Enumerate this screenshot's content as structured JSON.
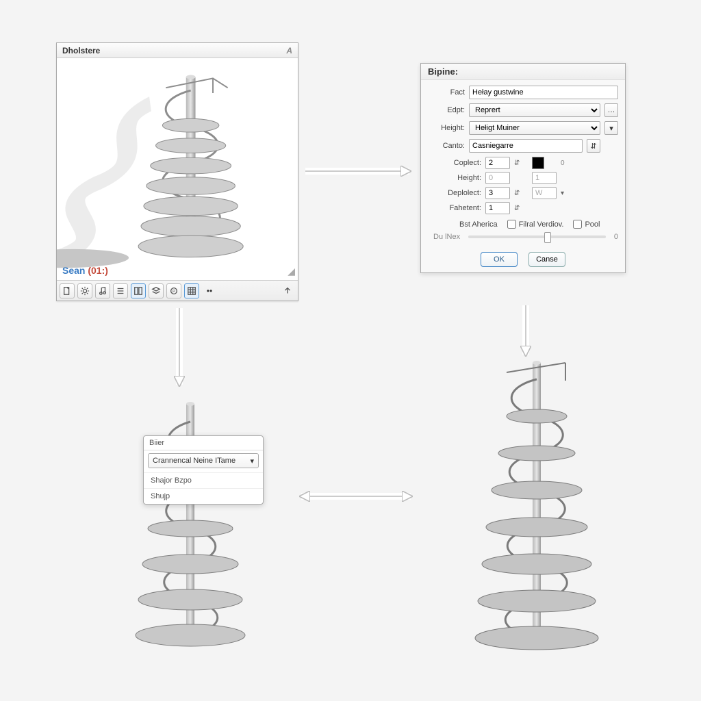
{
  "viewport": {
    "title": "Dholstere",
    "status_user": "Sean",
    "status_frame": "(01:)",
    "toolbar_icons": [
      "document-icon",
      "gear-icon",
      "music-icon",
      "bars-icon",
      "columns-icon",
      "layers-icon",
      "p-icon",
      "grid-icon",
      "more-icon"
    ],
    "nav_cursor_icon": "cursor-icon",
    "resize_icon": "resize-icon",
    "upload_icon": "upload-icon"
  },
  "props": {
    "title": "Bipine:",
    "fields": {
      "fact_label": "Fact",
      "fact_value": "Hełay gustwine",
      "edpt_label": "Edpt:",
      "edpt_value": "Reprert",
      "height_label": "Height:",
      "height_value": "Hełigt Muiner",
      "canto_label": "Canto:",
      "canto_value": "Casniegarre"
    },
    "sub": {
      "coplect_label": "Coplect:",
      "coplect_value": "2",
      "coplect_aux": "0",
      "height2_label": "Height:",
      "height2_value": "0",
      "height2_aux": "1",
      "deplolect_label": "Deplolect:",
      "deplolect_value": "3",
      "deplolect_aux": "W",
      "fahetent_label": "Fahetent:",
      "fahetent_value": "1"
    },
    "checks": {
      "bst_label": "Bst Aherica",
      "filral_label": "Filral Verdiov.",
      "pool_label": "Pool"
    },
    "slider_label": "Du lNex",
    "slider_value": "0",
    "ok_label": "OK",
    "cancel_label": "Canse"
  },
  "dropdown": {
    "header": "Biier",
    "selected": "Crannencal Neine ITame",
    "options": [
      "Shajor Bzpo",
      "Shujp"
    ]
  },
  "colors": {
    "panel_bg": "#f8f8f8",
    "accent": "#3d82c4"
  }
}
